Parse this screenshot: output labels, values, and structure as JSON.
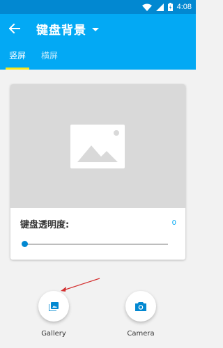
{
  "status_bar": {
    "time": "4:08",
    "icons": [
      "wifi-icon",
      "signal-icon",
      "battery-icon"
    ]
  },
  "app_bar": {
    "title": "键盘背景",
    "back_icon": "arrow-left-icon",
    "dropdown_icon": "caret-down-icon",
    "color": "#03a9f4"
  },
  "tabs": [
    {
      "label": "竖屏",
      "active": true
    },
    {
      "label": "横屏",
      "active": false
    }
  ],
  "preview_card": {
    "placeholder_icon": "image-placeholder-icon",
    "opacity_label": "键盘透明度:",
    "opacity_value": "0",
    "slider_value": 0
  },
  "actions": {
    "gallery_label": "Gallery",
    "gallery_icon": "image-icon",
    "camera_label": "Camera",
    "camera_icon": "camera-icon"
  },
  "colors": {
    "accent": "#03a9f4",
    "status_bar": "#0288d1",
    "tab_indicator": "#f8e71c"
  }
}
